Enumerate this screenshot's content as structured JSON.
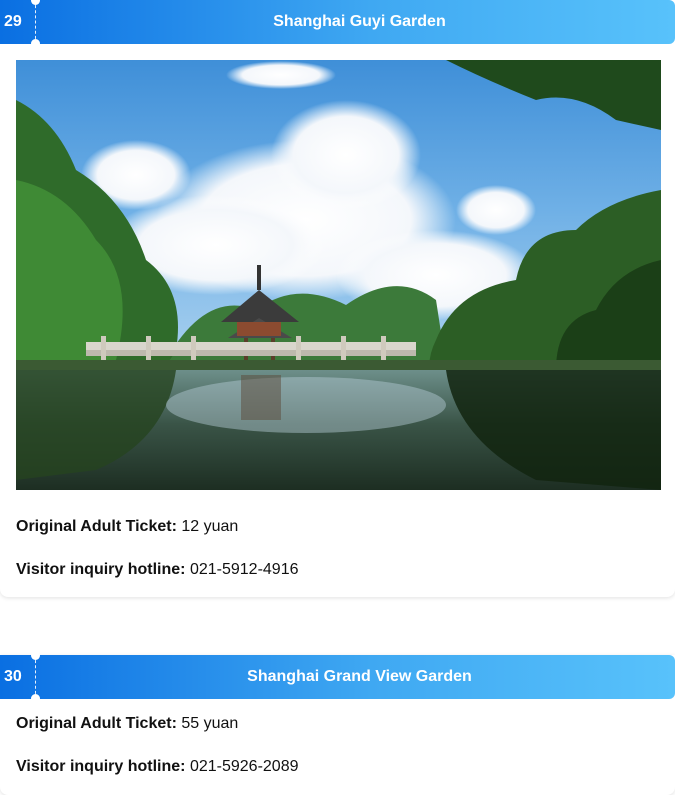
{
  "cards": [
    {
      "number": "29",
      "title": "Shanghai Guyi Garden",
      "ticket_label": "Original Adult Ticket:",
      "ticket_value": "12 yuan",
      "hotline_label": "Visitor inquiry hotline:",
      "hotline_value": "021-5912-4916"
    },
    {
      "number": "30",
      "title": "Shanghai Grand View Garden",
      "ticket_label": "Original Adult Ticket:",
      "ticket_value": "55 yuan",
      "hotline_label": "Visitor inquiry hotline:",
      "hotline_value": "021-5926-2089"
    }
  ],
  "colors": {
    "header_start": "#0a6fe2",
    "header_end": "#58c2fb"
  }
}
